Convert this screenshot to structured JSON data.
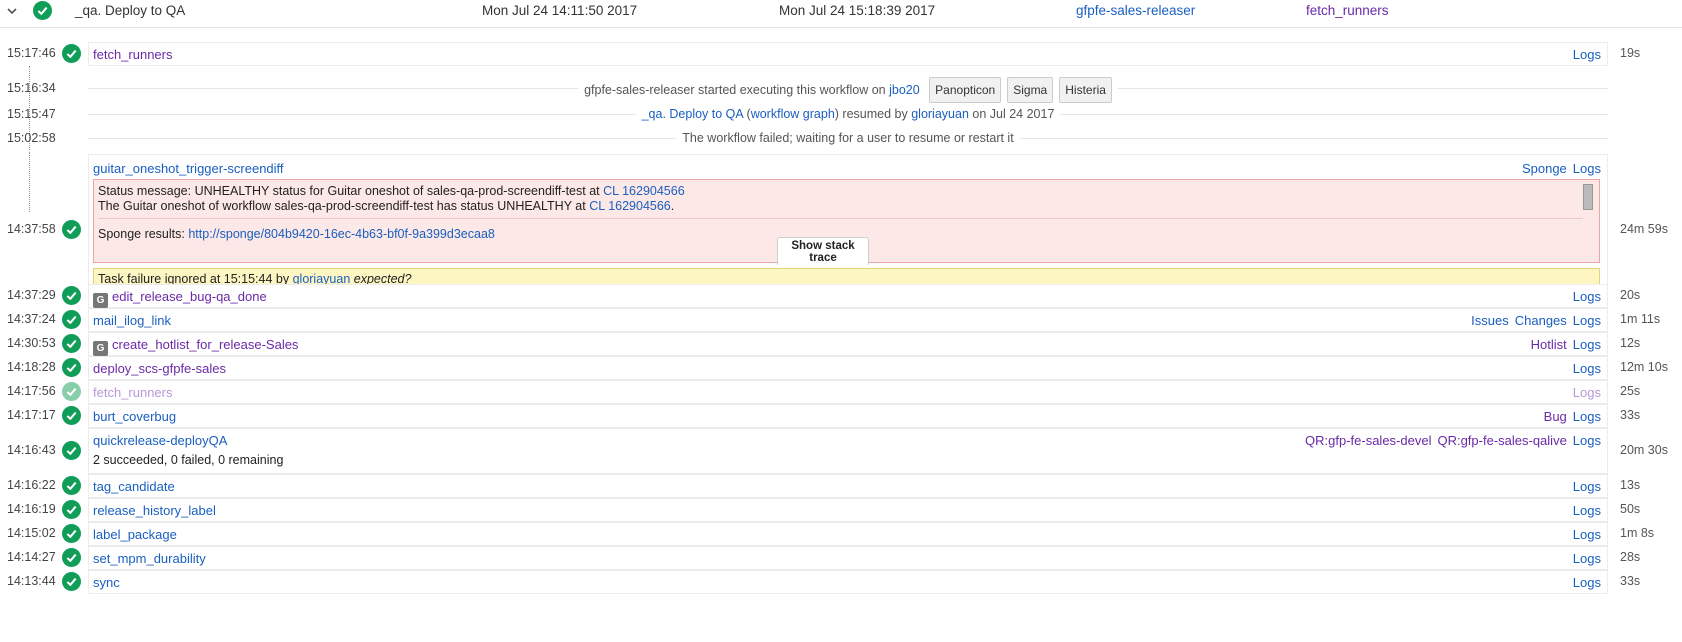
{
  "header": {
    "title": "_qa. Deploy to QA",
    "start": "Mon Jul 24 14:11:50 2017",
    "end": "Mon Jul 24 15:18:39 2017",
    "user": "gfpfe-sales-releaser",
    "task": "fetch_runners"
  },
  "events": {
    "started": {
      "time": "15:16:34",
      "text": "gfpfe-sales-releaser started executing this workflow on",
      "host": "jbo20",
      "chips": [
        "Panopticon",
        "Sigma",
        "Histeria"
      ]
    },
    "resumed": {
      "time": "15:15:47",
      "workflow": "_qa. Deploy to QA",
      "open_paren": "(",
      "graph_link": "workflow graph",
      "mid": ") resumed by",
      "user": "gloriayuan",
      "suffix": "on Jul 24 2017"
    },
    "failed": {
      "time": "15:02:58",
      "text": "The workflow failed; waiting for a user to resume or restart it"
    }
  },
  "guitar": {
    "time": "14:37:58",
    "name": "guitar_oneshot_trigger-screendiff",
    "link1": "Sponge",
    "link2": "Logs",
    "duration": "24m 59s",
    "error_line1_prefix": "Status message: UNHEALTHY status for Guitar oneshot of sales-qa-prod-screendiff-test at",
    "error_line2_prefix": "The Guitar oneshot of workflow sales-qa-prod-screendiff-test has status UNHEALTHY at",
    "cl_link": "CL 162904566",
    "period": ".",
    "sponge_label": "Sponge results:",
    "sponge_url": "http://sponge/804b9420-16ec-4b63-bf0f-9a399d3ecaa8",
    "stack_button": "Show stack trace",
    "ignored_prefix": "Task failure ignored at 15:15:44 by",
    "ignored_user": "gloriayuan",
    "ignored_note": "expected?"
  },
  "tasks": [
    {
      "time": "15:17:46",
      "name": "fetch_runners",
      "links": [
        "Logs"
      ],
      "duration": "19s",
      "badge": "",
      "state": "visited"
    },
    {
      "time": "14:37:29",
      "name": "edit_release_bug-qa_done",
      "links": [
        "Logs"
      ],
      "duration": "20s",
      "badge": "G",
      "state": "visited"
    },
    {
      "time": "14:37:24",
      "name": "mail_ilog_link",
      "links": [
        "Issues",
        "Changes",
        "Logs"
      ],
      "duration": "1m 11s",
      "badge": "",
      "state": "normal"
    },
    {
      "time": "14:30:53",
      "name": "create_hotlist_for_release-Sales",
      "links": [
        "Hotlist",
        "Logs"
      ],
      "duration": "12s",
      "badge": "G",
      "state": "visited"
    },
    {
      "time": "14:18:28",
      "name": "deploy_scs-gfpfe-sales",
      "links": [
        "Logs"
      ],
      "duration": "12m 10s",
      "badge": "",
      "state": "visited"
    },
    {
      "time": "14:17:56",
      "name": "fetch_runners",
      "links": [
        "Logs"
      ],
      "duration": "25s",
      "badge": "",
      "state": "faded"
    },
    {
      "time": "14:17:17",
      "name": "burt_coverbug",
      "links": [
        "Bug",
        "Logs"
      ],
      "duration": "33s",
      "badge": "",
      "state": "normal"
    },
    {
      "time": "14:16:43",
      "name": "quickrelease-deployQA",
      "links": [
        "QR:gfp-fe-sales-devel",
        "QR:gfp-fe-sales-qalive",
        "Logs"
      ],
      "duration": "20m 30s",
      "badge": "",
      "state": "normal",
      "sub": "2 succeeded, 0 failed, 0 remaining"
    },
    {
      "time": "14:16:22",
      "name": "tag_candidate",
      "links": [
        "Logs"
      ],
      "duration": "13s",
      "badge": "",
      "state": "normal"
    },
    {
      "time": "14:16:19",
      "name": "release_history_label",
      "links": [
        "Logs"
      ],
      "duration": "50s",
      "badge": "",
      "state": "normal"
    },
    {
      "time": "14:15:02",
      "name": "label_package",
      "links": [
        "Logs"
      ],
      "duration": "1m 8s",
      "badge": "",
      "state": "normal"
    },
    {
      "time": "14:14:27",
      "name": "set_mpm_durability",
      "links": [
        "Logs"
      ],
      "duration": "28s",
      "badge": "",
      "state": "normal"
    },
    {
      "time": "14:13:44",
      "name": "sync",
      "links": [
        "Logs"
      ],
      "duration": "33s",
      "badge": "",
      "state": "normal"
    }
  ]
}
